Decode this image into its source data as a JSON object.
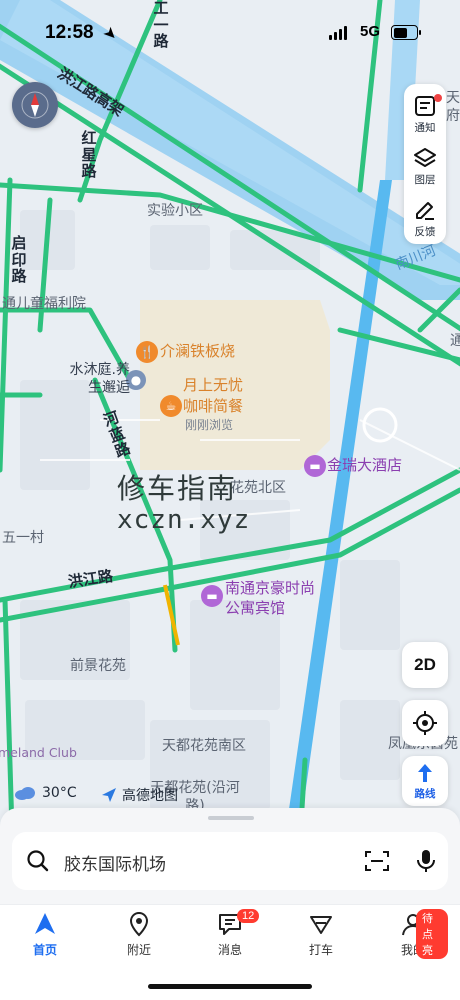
{
  "status": {
    "time": "12:58",
    "network": "5G"
  },
  "map": {
    "roads": {
      "hongjiang_viaduct": "洪江路高架",
      "hongxing": "红星路",
      "qiyin": "启印路",
      "hehua": "河蓝路",
      "hongjiang": "洪江路",
      "nanchuan": "南川河",
      "gongyi": "工一路"
    },
    "areas": {
      "shiyan": "实验小区",
      "children_welfare": "通儿童福利院",
      "wuyi": "五一村",
      "qianjing": "前景花苑",
      "tiandu_nan": "天都花苑南区",
      "tiandu_yan": "天都花苑(沿河路)",
      "huayuan_bei": "花苑北区",
      "fenghuang": "凤凰东茵苑",
      "homeland": "meland Club",
      "tian_edge": "天府",
      "tong_edge": "通"
    },
    "pois": {
      "jielan": "介澜铁板烧",
      "yueshang_1": "月上无忧",
      "yueshang_2": "咖啡简餐",
      "yueshang_sub": "刚刚浏览",
      "shuimu": "水沐庭.养生邂逅",
      "jinrui": "金瑞大酒店",
      "nantong_hotel": "南通京豪时尚公寓宾馆"
    },
    "watermark": {
      "line1": "修车指南",
      "line2": "xczn.xyz"
    }
  },
  "toolbar": {
    "notify": "通知",
    "layers": "图层",
    "feedback": "反馈"
  },
  "controls": {
    "view_mode": "2D",
    "route": "路线"
  },
  "weather": {
    "temp": "30°C"
  },
  "logo": {
    "text": "高德地图"
  },
  "search": {
    "placeholder": "胶东国际机场"
  },
  "tabs": [
    {
      "label": "首页"
    },
    {
      "label": "附近"
    },
    {
      "label": "消息",
      "badge": "12"
    },
    {
      "label": "打车"
    },
    {
      "label": "我的",
      "badge": "待点亮"
    }
  ],
  "colors": {
    "road_green": "#2ec27e",
    "water": "#49b3f0",
    "accent": "#1e6ef0",
    "badge": "#ff3b30"
  }
}
